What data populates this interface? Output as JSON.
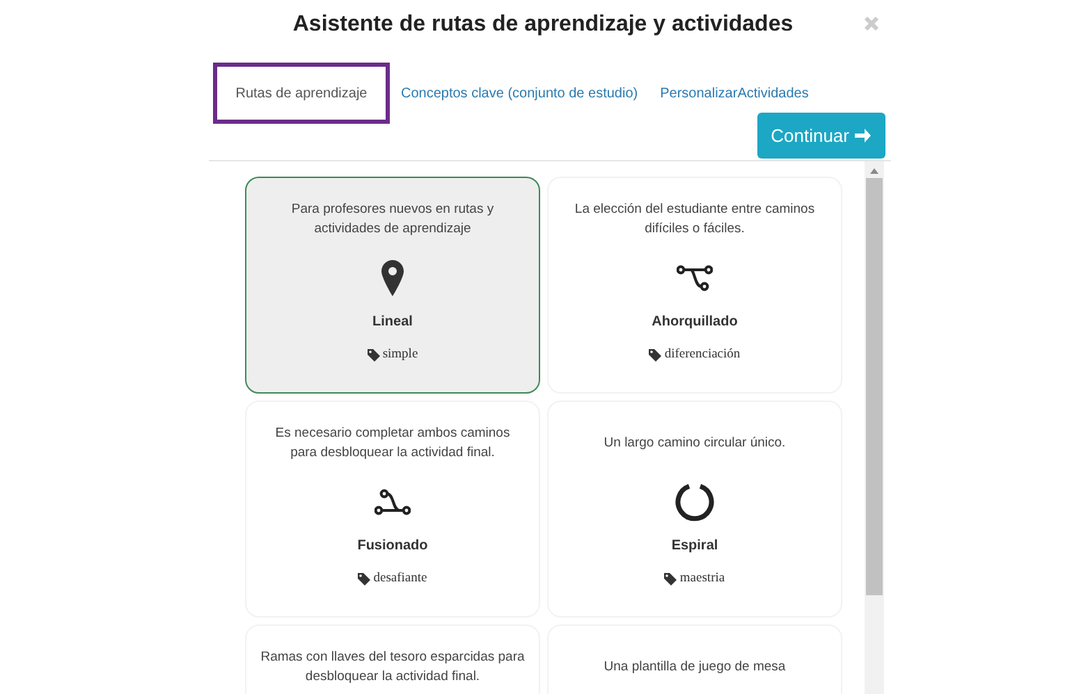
{
  "window": {
    "title": "Asistente de rutas de aprendizaje y actividades"
  },
  "tabs": [
    {
      "label": "Rutas de aprendizaje",
      "selected": true
    },
    {
      "label": "Conceptos clave (conjunto de estudio)",
      "selected": false
    },
    {
      "label": "PersonalizarActividades",
      "selected": false
    }
  ],
  "continue_button": {
    "label": "Continuar"
  },
  "cards": [
    {
      "description": "Para profesores nuevos en rutas y actividades de aprendizaje",
      "kind": "pin",
      "title": "Lineal",
      "tag": "simple",
      "selected": true
    },
    {
      "description": "La elección del estudiante entre caminos difíciles o fáciles.",
      "kind": "fork",
      "title": "Ahorquillado",
      "tag": "diferenciación",
      "selected": false
    },
    {
      "description": "Es necesario completar ambos caminos para desbloquear la actividad final.",
      "kind": "merge",
      "title": "Fusionado",
      "tag": "desafiante",
      "selected": false
    },
    {
      "description": "Un largo camino circular único.",
      "kind": "ring",
      "title": "Espiral",
      "tag": "maestria",
      "selected": false
    },
    {
      "description": "Ramas con llaves del tesoro esparcidas para desbloquear la actividad final.",
      "selected": false
    },
    {
      "description": "Una plantilla de juego de mesa",
      "selected": false
    }
  ]
}
